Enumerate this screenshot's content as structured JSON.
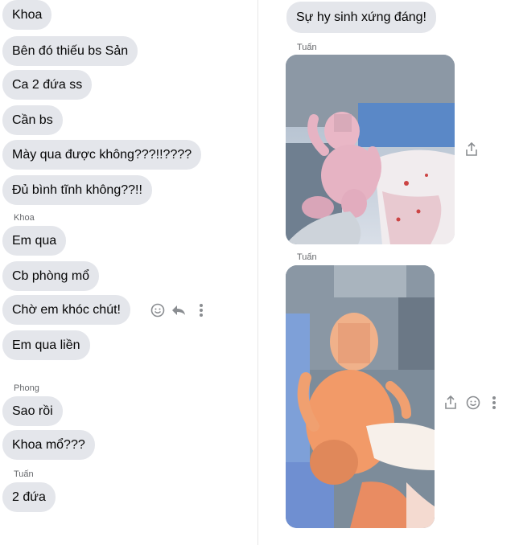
{
  "left_thread": {
    "group1": [
      "Khoa",
      "Bên đó thiếu bs Sản",
      "Ca 2 đứa ss",
      "Cần bs",
      "Mày qua được không???!!????",
      "Đủ bình tĩnh không??!!"
    ],
    "sender_khoa": "Khoa",
    "group2": [
      "Em qua",
      "Cb phòng mổ",
      "Chờ em khóc chút!",
      "Em qua liền"
    ],
    "sender_phong": "Phong",
    "group3": [
      "Sao rồi",
      "Khoa mổ???"
    ],
    "sender_tuan": "Tuấn",
    "group4": [
      "2 đứa"
    ]
  },
  "right_thread": {
    "message": "Sự hy sinh xứng đáng!",
    "sender1": "Tuấn",
    "sender2": "Tuấn"
  },
  "icons": {
    "react": "smile-icon",
    "reply": "reply-icon",
    "more": "more-icon",
    "share": "share-icon"
  },
  "colors": {
    "bubble": "#e4e6eb",
    "meta": "#65676b",
    "icon": "#8a8d91"
  }
}
